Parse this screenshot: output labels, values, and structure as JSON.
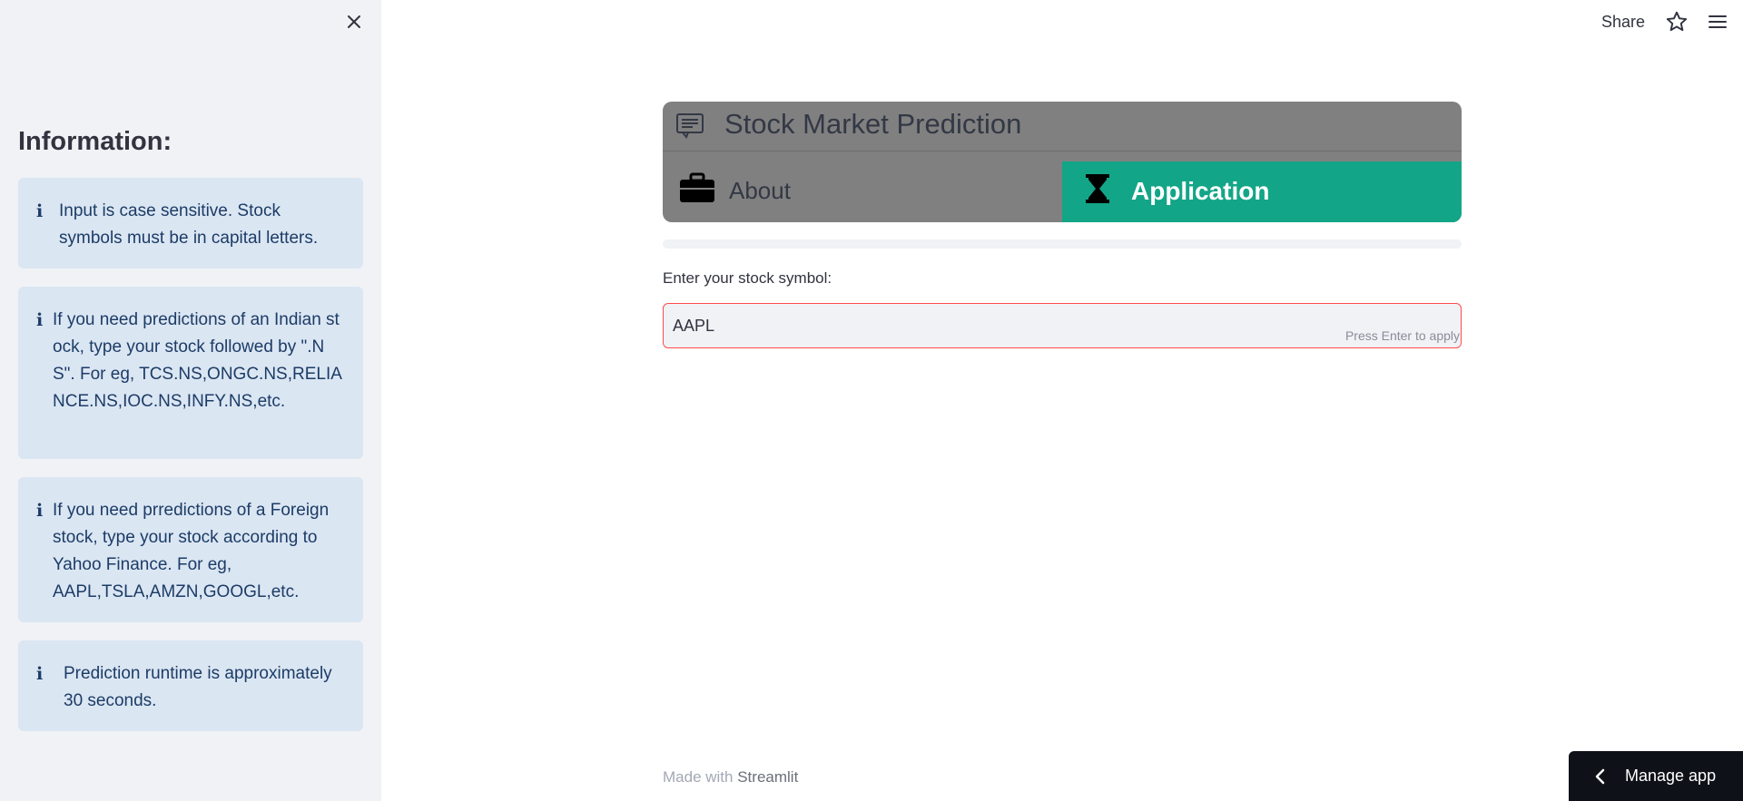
{
  "sidebar": {
    "heading": "Information:",
    "info_boxes": [
      {
        "icon": "info-icon",
        "text": "Input is case sensitive. Stock symbols must be in capital letters."
      },
      {
        "icon": "info-icon",
        "text": "If you need predictions of an Indian stock, type your stock followed by \".NS\". For eg, TCS.NS,ONGC.NS,RELIANCE.NS,IOC.NS,INFY.NS,etc."
      },
      {
        "icon": "info-icon",
        "text": "If you need prredictions of a Foreign stock, type your stock according to Yahoo Finance. For eg, AAPL,TSLA,AMZN,GOOGL,etc."
      },
      {
        "icon": "info-icon",
        "text": "Prediction runtime is approximately 30 seconds."
      }
    ]
  },
  "toolbar": {
    "share_label": "Share"
  },
  "nav": {
    "title": "Stock Market Prediction",
    "tabs": [
      {
        "label": "About",
        "icon": "briefcase-icon",
        "selected": false
      },
      {
        "label": "Application",
        "icon": "hourglass-icon",
        "selected": true
      }
    ],
    "accent_color": "#13a587"
  },
  "form": {
    "label": "Enter your stock symbol:",
    "value": "AAPL",
    "hint": "Press Enter to apply"
  },
  "footer": {
    "prefix": "Made with",
    "brand": "Streamlit"
  },
  "manage_app": {
    "label": "Manage app"
  }
}
